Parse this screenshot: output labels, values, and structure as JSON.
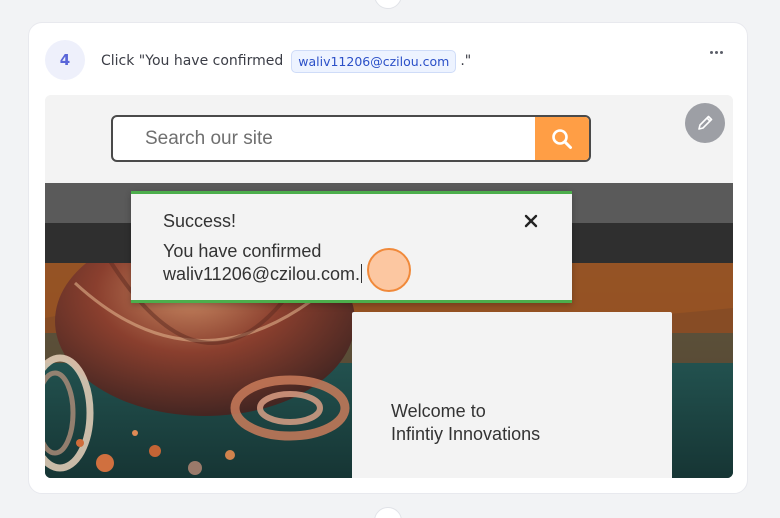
{
  "step": {
    "number": "4",
    "instruction_prefix": "Click \"You have confirmed",
    "instruction_chip": "waliv11206@czilou.com",
    "instruction_suffix": ".\"",
    "more_icon": "ellipsis-horizontal-icon"
  },
  "screenshot": {
    "search": {
      "placeholder": "Search our site",
      "button_icon": "magnifier-icon",
      "button_color": "#ff9e45"
    },
    "edit_icon": "pencil-icon",
    "toast": {
      "title": "Success!",
      "message_line1": "You have confirmed",
      "message_line2": "waliv11206@czilou.com.",
      "close_icon": "close-x-icon",
      "accent_color": "#4cae4c"
    },
    "welcome": {
      "line1": "Welcome to",
      "line2": "Infintiy Innovations"
    },
    "click_marker_color": "#f0893a"
  }
}
